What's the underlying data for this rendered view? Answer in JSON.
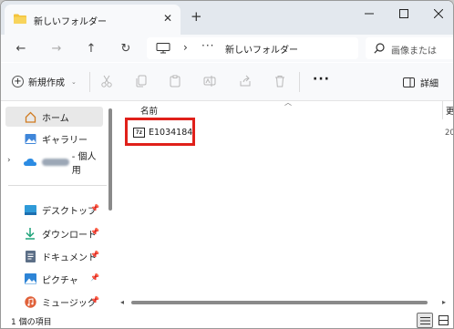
{
  "window": {
    "tab_title": "新しいフォルダー",
    "tab_close": "✕",
    "new_tab": "+",
    "minimize": "—",
    "maximize": "☐",
    "close": "✕"
  },
  "nav": {
    "back": "←",
    "forward": "→",
    "up": "↑",
    "refresh": "↻",
    "breadcrumb_separator": "›",
    "breadcrumb_more": "···",
    "current_folder": "新しいフォルダー",
    "search_placeholder": "画像または"
  },
  "commandbar": {
    "new_label": "新規作成",
    "more": "···",
    "details_label": "詳細"
  },
  "sidebar": {
    "items": [
      {
        "label": "ホーム",
        "icon": "home-icon",
        "selected": true
      },
      {
        "label": "ギャラリー",
        "icon": "gallery-icon"
      },
      {
        "label": "- 個人用",
        "icon": "onedrive-icon"
      },
      {
        "label": "デスクトップ",
        "icon": "desktop-icon",
        "pinned": true
      },
      {
        "label": "ダウンロード",
        "icon": "download-icon",
        "pinned": true
      },
      {
        "label": "ドキュメント",
        "icon": "documents-icon",
        "pinned": true
      },
      {
        "label": "ピクチャ",
        "icon": "pictures-icon",
        "pinned": true
      },
      {
        "label": "ミュージック",
        "icon": "music-icon",
        "pinned": true
      }
    ]
  },
  "content": {
    "column_name": "名前",
    "column_modified": "更",
    "files": [
      {
        "name": "E1034184",
        "icon_text": "7z",
        "date_fragment": "20"
      }
    ]
  },
  "status": {
    "item_count": "1 個の項目"
  },
  "colors": {
    "titlebar": "#e3e8ee",
    "highlight_box": "#e0201a",
    "folder": "#f3c33c"
  }
}
